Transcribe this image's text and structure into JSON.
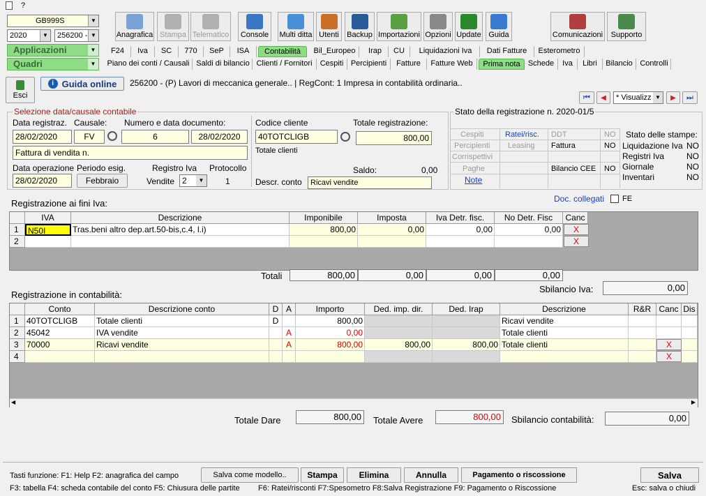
{
  "window": {
    "menu_label": "?"
  },
  "top": {
    "company": "GB999S",
    "year": "2020",
    "company_code": "256200 -",
    "applicazioni": "Applicazioni",
    "quadri": "Quadri"
  },
  "toolbar": [
    {
      "label": "Anagrafica",
      "icon": "vehicle-icon",
      "color": "#7aa2d6"
    },
    {
      "label": "Stampa",
      "icon": "printer-icon",
      "color": "#b0b0b0",
      "disabled": true
    },
    {
      "label": "Telematico",
      "icon": "pen-icon",
      "color": "#b0b0b0",
      "disabled": true
    },
    {
      "label": "Console",
      "icon": "console-icon",
      "color": "#3a76c4"
    },
    {
      "label": "Multi ditta",
      "icon": "network-icon",
      "color": "#4a90d9"
    },
    {
      "label": "Utenti",
      "icon": "users-icon",
      "color": "#c8702a"
    },
    {
      "label": "Backup",
      "icon": "backup-icon",
      "color": "#2a5a9a"
    },
    {
      "label": "Importazioni",
      "icon": "import-icon",
      "color": "#5aa040"
    },
    {
      "label": "Opzioni",
      "icon": "tools-icon",
      "color": "#888888"
    },
    {
      "label": "Update",
      "icon": "update-icon",
      "color": "#2a8a2a"
    },
    {
      "label": "Guida",
      "icon": "help-icon",
      "color": "#3a7ad0"
    },
    {
      "label": "Comunicazioni",
      "icon": "communications-icon",
      "color": "#b04040"
    },
    {
      "label": "Supporto",
      "icon": "support-icon",
      "color": "#4a8a4a"
    }
  ],
  "tabs_row1": [
    "F24",
    "Iva",
    "SC",
    "770",
    "SeP",
    "ISA",
    "Contabilità",
    "Bil_Europeo",
    "Irap",
    "CU",
    "Liquidazioni Iva",
    "Dati Fatture",
    "Esterometro"
  ],
  "tabs_row2": [
    "Piano dei conti / Causali",
    "Saldi di bilancio",
    "Clienti / Fornitori",
    "Cespiti",
    "Percipienti",
    "Fatture",
    "Fatture Web",
    "Prima nota",
    "Schede",
    "Iva",
    "Libri",
    "Bilancio",
    "Controlli"
  ],
  "header": {
    "esci": "Esci",
    "guida_online": "Guida online",
    "title": "256200 - (P) Lavori di meccanica generale.. | RegCont: 1 Impresa  in contabilità ordinaria..",
    "nav_select": "* Visualizz"
  },
  "selection": {
    "legend": "Selezione data/causale contabile",
    "data_registraz_label": "Data registraz.",
    "data_registraz": "28/02/2020",
    "causale_label": "Causale:",
    "causale": "FV",
    "numero_label": "Numero e data documento:",
    "numero": "6",
    "data_documento": "28/02/2020",
    "descrizione": "Fattura di vendita n.",
    "data_operazione_label": "Data operazione",
    "data_operazione": "28/02/2020",
    "periodo_label": "Periodo esig.",
    "periodo": "Febbraio",
    "registro_label": "Registro Iva",
    "registro_sub": "Vendite",
    "registro": "2",
    "protocollo_label": "Protocollo",
    "protocollo": "1",
    "codice_cliente_label": "Codice cliente",
    "codice_cliente": "40TOTCLIGB",
    "totale_clienti": "Totale clienti",
    "totale_label": "Totale registrazione:",
    "totale": "800,00",
    "saldo_label": "Saldo:",
    "saldo": "0,00",
    "descr_conto_label": "Descr. conto",
    "descr_conto": "Ricavi vendite"
  },
  "stato": {
    "legend": "Stato della registrazione n. 2020-01/5",
    "cespiti": "Cespiti",
    "ratei": "Ratei/risc.",
    "ddt": "DDT",
    "ddt_val": "NO",
    "percipienti": "Percipienti",
    "leasing": "Leasing",
    "fattura": "Fattura",
    "fattura_val": "NO",
    "corrispettivi": "Corrispettivi",
    "paghe": "Paghe",
    "bilancio_cee": "Bilancio CEE",
    "bilancio_cee_val": "NO",
    "note": "Note",
    "stampe_title": "Stato delle stampe:",
    "stampe": [
      {
        "label": "Liquidazione Iva",
        "val": "NO"
      },
      {
        "label": "Registri Iva",
        "val": "NO"
      },
      {
        "label": "Giornale",
        "val": "NO"
      },
      {
        "label": "Inventari",
        "val": "NO"
      }
    ]
  },
  "doc_collegati": {
    "label": "Doc. collegati",
    "fe": "FE"
  },
  "iva": {
    "title": "Registrazione ai fini Iva:",
    "headers": [
      "IVA",
      "Descrizione",
      "Imponibile",
      "Imposta",
      "Iva Detr. fisc.",
      "No Detr. Fisc",
      "Canc"
    ],
    "rows": [
      {
        "n": "1",
        "iva": "N50I",
        "descr": "Tras.beni altro dep.art.50-bis,c.4, l.i)",
        "imponibile": "800,00",
        "imposta": "0,00",
        "detr": "0,00",
        "nodetr": "0,00",
        "canc": "X"
      },
      {
        "n": "2",
        "iva": "",
        "descr": "",
        "imponibile": "",
        "imposta": "",
        "detr": "",
        "nodetr": "",
        "canc": "X"
      }
    ],
    "totali_label": "Totali",
    "totali": [
      "800,00",
      "0,00",
      "0,00",
      "0,00"
    ],
    "sbilancio_label": "Sbilancio Iva:",
    "sbilancio": "0,00"
  },
  "cont": {
    "title": "Registrazione in contabilità:",
    "headers": [
      "Conto",
      "Descrizione conto",
      "D",
      "A",
      "Importo",
      "Ded. imp. dir.",
      "Ded. Irap",
      "Descrizione",
      "R&R",
      "Canc",
      "Dis"
    ],
    "rows": [
      {
        "n": "1",
        "conto": "40TOTCLIGB",
        "descr": "Totale clienti",
        "d": "D",
        "a": "",
        "importo": "800,00",
        "ded": "",
        "irap": "",
        "descrizione": "Ricavi vendite",
        "red": false
      },
      {
        "n": "2",
        "conto": "45042",
        "descr": "IVA vendite",
        "d": "",
        "a": "A",
        "importo": "0,00",
        "ded": "",
        "irap": "",
        "descrizione": "Totale clienti",
        "red": true
      },
      {
        "n": "3",
        "conto": "70000",
        "descr": "Ricavi vendite",
        "d": "",
        "a": "A",
        "importo": "800,00",
        "ded": "800,00",
        "irap": "800,00",
        "descrizione": "Totale clienti",
        "red": true,
        "canc": "X"
      },
      {
        "n": "4",
        "conto": "",
        "descr": "",
        "d": "",
        "a": "",
        "importo": "",
        "ded": "",
        "irap": "",
        "descrizione": "",
        "red": false,
        "canc": "X"
      }
    ],
    "totale_dare_label": "Totale Dare",
    "totale_dare": "800,00",
    "totale_avere_label": "Totale Avere",
    "totale_avere": "800,00",
    "sbilancio_label": "Sbilancio contabilità:",
    "sbilancio": "0,00"
  },
  "footer": {
    "keys1": "Tasti funzione: F1: Help  F2: anagrafica del campo",
    "keys2a": "F3: tabella   F4: scheda contabile del conto  F5: Chiusura delle partite",
    "keys2b": "F6: Ratei/risconti   F7:Spesometro   F8:Salva Registrazione    F9: Pagamento o Riscossione",
    "salva_modello": "Salva come modello..",
    "stampa": "Stampa",
    "elimina": "Elimina",
    "annulla": "Annulla",
    "pagamento": "Pagamento o riscossione",
    "salva": "Salva",
    "esc": "Esc: salva o chiudi"
  },
  "colors": {
    "accent_green": "#8fdc86",
    "field_yellow": "#ffffe1",
    "red": "#e00000",
    "link_blue": "#1a3fc4"
  }
}
